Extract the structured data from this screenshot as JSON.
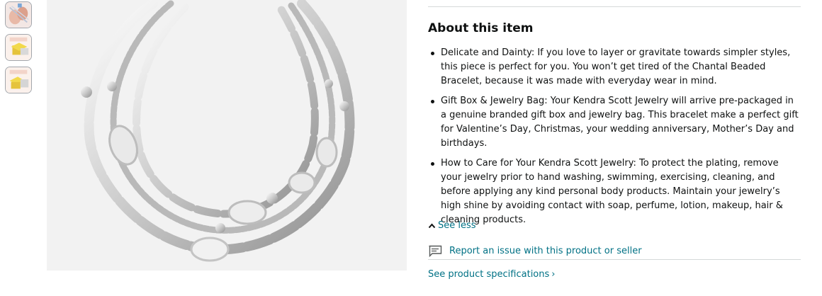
{
  "thumbnails": [
    {
      "icon": "thumbnail-hands-image"
    },
    {
      "icon": "thumbnail-gift-box-yellow-image"
    },
    {
      "icon": "thumbnail-gift-box-yellow-image-2"
    }
  ],
  "main_image": {
    "icon": "bracelet-product-image"
  },
  "about": {
    "title": "About this item",
    "bullets": [
      "Delicate and Dainty: If you love to layer or gravitate towards simpler styles, this piece is perfect for you. You won’t get tired of the Chantal Beaded Bracelet, because it was made with everyday wear in mind.",
      "Gift Box & Jewelry Bag: Your Kendra Scott Jewelry will arrive pre-packaged in a genuine branded gift box and jewelry bag. This bracelet make a perfect gift for Valentine’s Day, Christmas, your wedding anniversary, Mother’s Day and birthdays.",
      "How to Care for Your Kendra Scott Jewelry: To protect the plating, remove your jewelry prior to hand washing, swimming, exercising, cleaning, and before applying any kind personal body products. Maintain your jewelry’s high shine by avoiding contact with soap, perfume, lotion, makeup, hair & cleaning products."
    ],
    "see_less": "See less"
  },
  "report": {
    "label": "Report an issue with this product or seller",
    "icon": "feedback-icon"
  },
  "specs": {
    "label": "See product specifications"
  },
  "colors": {
    "link": "#007185",
    "text": "#0f1111",
    "divider": "#d5d9d9"
  }
}
